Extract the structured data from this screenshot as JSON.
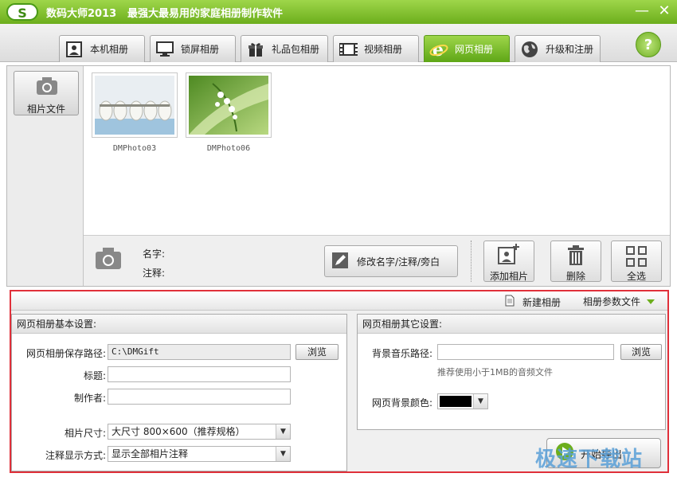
{
  "app": {
    "logo_text": "S",
    "title": "数码大师2013",
    "slogan": "最强大最易用的家庭相册制作软件",
    "minimize_glyph": "—",
    "close_glyph": "✕"
  },
  "tabs": [
    {
      "label": "本机相册",
      "icon": "portrait-frame-icon",
      "active": false
    },
    {
      "label": "锁屏相册",
      "icon": "monitor-icon",
      "active": false
    },
    {
      "label": "礼品包相册",
      "icon": "gift-icon",
      "active": false
    },
    {
      "label": "视频相册",
      "icon": "film-strip-icon",
      "active": false
    },
    {
      "label": "网页相册",
      "icon": "ie-browser-icon",
      "active": true
    },
    {
      "label": "升级和注册",
      "icon": "globe-icon",
      "active": false
    }
  ],
  "help_label": "?",
  "sidebar": {
    "photo_files_label": "相片文件"
  },
  "photos": [
    {
      "caption": "DMPhoto03"
    },
    {
      "caption": "DMPhoto06"
    }
  ],
  "info": {
    "name_label": "名字:",
    "note_label": "注释:",
    "edit_button": "修改名字/注释/旁白"
  },
  "actions": {
    "add_photo": "添加相片",
    "delete": "删除",
    "select_all": "全选"
  },
  "lower_toolbar": {
    "new_album": "新建相册",
    "album_params": "相册参数文件"
  },
  "basic_settings": {
    "heading": "网页相册基本设置:",
    "save_path_label": "网页相册保存路径:",
    "save_path_value": "C:\\DMGift",
    "browse": "浏览",
    "title_label": "标题:",
    "title_value": "",
    "author_label": "制作者:",
    "author_value": "",
    "size_label": "相片尺寸:",
    "size_value": "大尺寸 800×600（推荐规格）",
    "note_mode_label": "注释显示方式:",
    "note_mode_value": "显示全部相片注释"
  },
  "other_settings": {
    "heading": "网页相册其它设置:",
    "music_label": "背景音乐路径:",
    "music_value": "",
    "browse": "浏览",
    "music_hint": "推荐使用小于1MB的音频文件",
    "bg_color_label": "网页背景颜色:",
    "bg_color": "#000000"
  },
  "start_button": "开始导出",
  "watermark": "极速下载站",
  "colors": {
    "accent_green": "#6cae1c",
    "highlight_border": "#e0303a"
  }
}
